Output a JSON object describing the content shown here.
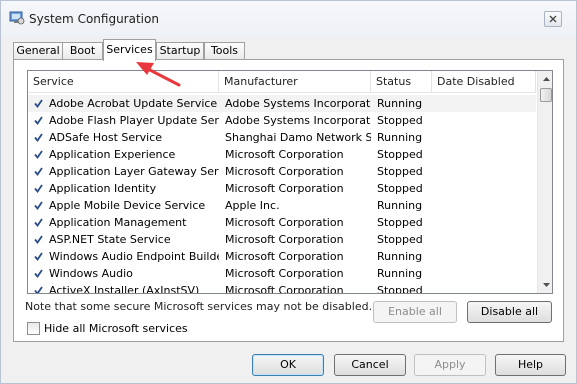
{
  "window": {
    "title": "System Configuration"
  },
  "tabs": [
    {
      "label": "General"
    },
    {
      "label": "Boot"
    },
    {
      "label": "Services",
      "active": true
    },
    {
      "label": "Startup"
    },
    {
      "label": "Tools"
    }
  ],
  "services_table": {
    "columns": [
      "Service",
      "Manufacturer",
      "Status",
      "Date Disabled"
    ],
    "rows": [
      {
        "service": "Adobe Acrobat Update Service",
        "manufacturer": "Adobe Systems Incorporated",
        "status": "Running",
        "checked": true
      },
      {
        "service": "Adobe Flash Player Update Service",
        "manufacturer": "Adobe Systems Incorporated",
        "status": "Stopped",
        "checked": true
      },
      {
        "service": "ADSafe Host Service",
        "manufacturer": "Shanghai Damo Network S...",
        "status": "Running",
        "checked": true
      },
      {
        "service": "Application Experience",
        "manufacturer": "Microsoft Corporation",
        "status": "Stopped",
        "checked": true
      },
      {
        "service": "Application Layer Gateway Service",
        "manufacturer": "Microsoft Corporation",
        "status": "Stopped",
        "checked": true
      },
      {
        "service": "Application Identity",
        "manufacturer": "Microsoft Corporation",
        "status": "Stopped",
        "checked": true
      },
      {
        "service": "Apple Mobile Device Service",
        "manufacturer": "Apple Inc.",
        "status": "Running",
        "checked": true
      },
      {
        "service": "Application Management",
        "manufacturer": "Microsoft Corporation",
        "status": "Stopped",
        "checked": true
      },
      {
        "service": "ASP.NET State Service",
        "manufacturer": "Microsoft Corporation",
        "status": "Stopped",
        "checked": true
      },
      {
        "service": "Windows Audio Endpoint Builder",
        "manufacturer": "Microsoft Corporation",
        "status": "Running",
        "checked": true
      },
      {
        "service": "Windows Audio",
        "manufacturer": "Microsoft Corporation",
        "status": "Running",
        "checked": true
      },
      {
        "service": "ActiveX Installer (AxInstSV)",
        "manufacturer": "Microsoft Corporation",
        "status": "Stopped",
        "checked": true
      }
    ]
  },
  "note": "Note that some secure Microsoft services may not be disabled.",
  "buttons": {
    "enable_all": "Enable all",
    "disable_all": "Disable all",
    "ok": "OK",
    "cancel": "Cancel",
    "apply": "Apply",
    "help": "Help"
  },
  "hide_ms": {
    "label": "Hide all Microsoft services",
    "checked": false
  },
  "colors": {
    "annotation_arrow": "#e8383d",
    "checkbox_mark": "#2a4d8a",
    "default_button_border": "#3c7fb1"
  },
  "icons": [
    "app-icon",
    "close-icon",
    "checkbox-icon",
    "scroll-up-icon",
    "scroll-down-icon",
    "annotation-arrow"
  ]
}
